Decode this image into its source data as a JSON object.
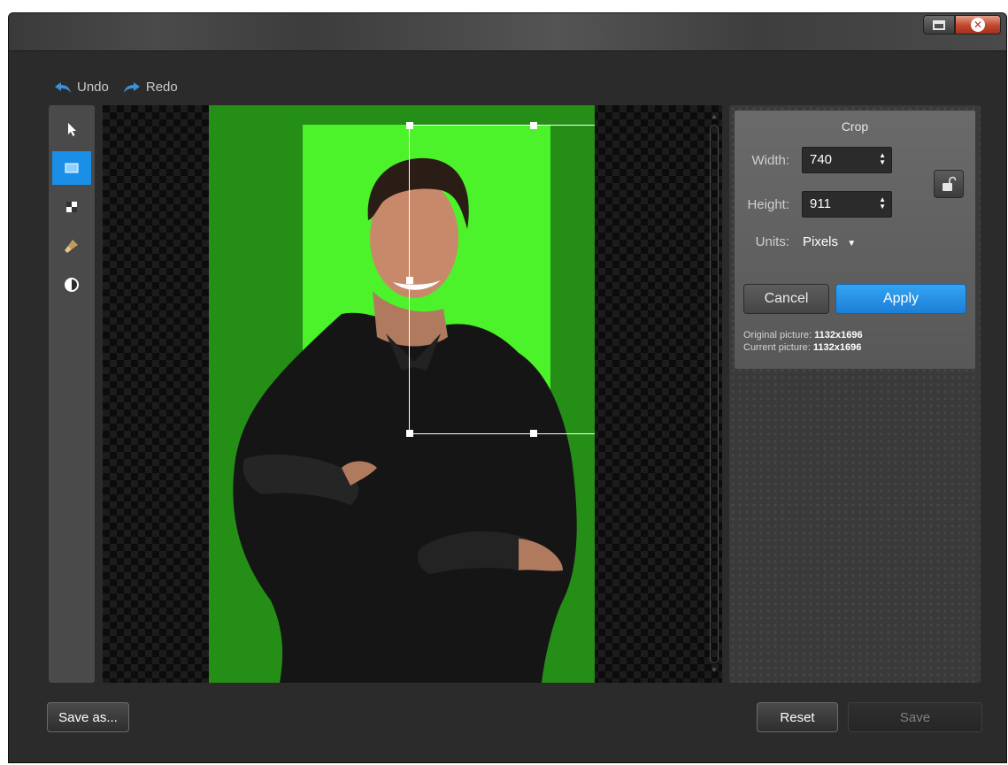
{
  "window": {
    "title_buttons": [
      "maximize-icon",
      "close-icon"
    ]
  },
  "history": {
    "undo_label": "Undo",
    "redo_label": "Redo"
  },
  "tools": [
    {
      "name": "select-tool",
      "icon": "cursor-arrow-icon",
      "active": false
    },
    {
      "name": "crop-tool",
      "icon": "rectangle-crop-icon",
      "active": true
    },
    {
      "name": "background-tool",
      "icon": "checker-square-icon",
      "active": false
    },
    {
      "name": "brush-tool",
      "icon": "brush-icon",
      "active": false
    },
    {
      "name": "contrast-tool",
      "icon": "contrast-circle-icon",
      "active": false
    }
  ],
  "crop": {
    "title": "Crop",
    "width_label": "Width:",
    "width_value": "740",
    "height_label": "Height:",
    "height_value": "911",
    "units_label": "Units:",
    "units_value": "Pixels",
    "lock_icon": "unlocked-padlock-icon",
    "cancel_label": "Cancel",
    "apply_label": "Apply",
    "original_label": "Original picture:",
    "original_value": "1132x1696",
    "current_label": "Current picture:",
    "current_value": "1132x1696"
  },
  "footer": {
    "save_as_label": "Save as...",
    "reset_label": "Reset",
    "save_label": "Save"
  },
  "colors": {
    "accent": "#1a8fe8",
    "photo_background": "#258e17",
    "crop_highlight": "#4cf22a"
  }
}
